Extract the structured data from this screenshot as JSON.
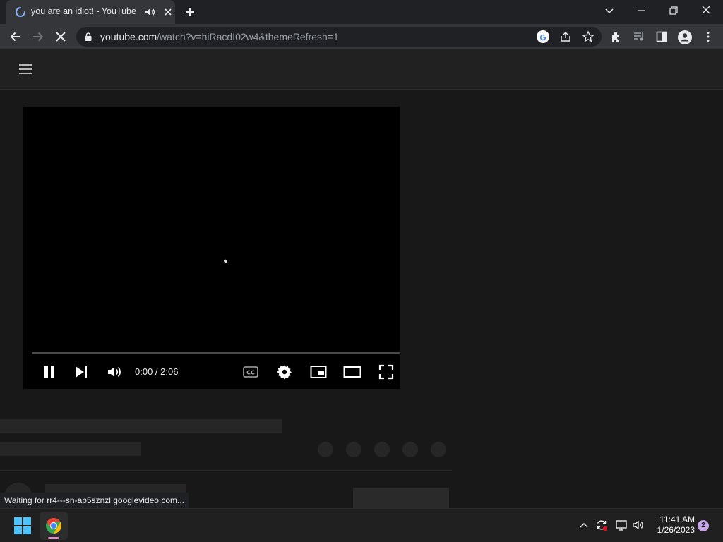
{
  "browser": {
    "tab": {
      "title": "you are an idiot! - YouTube"
    },
    "url": {
      "host": "youtube.com",
      "path": "/watch?v=hiRacdI02w4&themeRefresh=1"
    },
    "status_text": "Waiting for rr4---sn-ab5sznzl.googlevideo.com..."
  },
  "player": {
    "time": "0:00 / 2:06",
    "progress_fraction": 0
  },
  "taskbar": {
    "time": "11:41 AM",
    "date": "1/26/2023",
    "notification_count": "2"
  },
  "icons": {
    "tab": [
      "loading-spinner-icon",
      "audio-playing-icon",
      "close-icon"
    ],
    "toolbar": [
      "back-arrow-icon",
      "forward-arrow-icon",
      "stop-icon",
      "lock-icon",
      "google-icon",
      "share-icon",
      "star-icon",
      "extensions-icon",
      "media-control-icon",
      "side-panel-icon",
      "profile-icon",
      "kebab-menu-icon"
    ],
    "player": [
      "pause-icon",
      "next-icon",
      "volume-icon",
      "captions-icon",
      "settings-icon",
      "miniplayer-icon",
      "theater-mode-icon",
      "fullscreen-icon"
    ]
  }
}
